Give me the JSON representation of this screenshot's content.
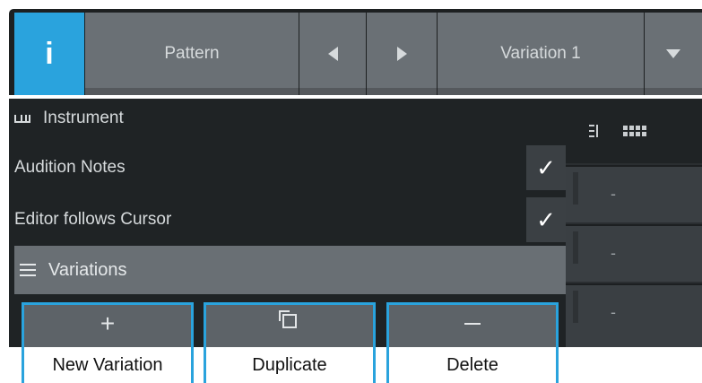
{
  "toolbar": {
    "info_label": "i",
    "pattern_label": "Pattern",
    "variation_label": "Variation 1"
  },
  "panel": {
    "instrument_label": "Instrument",
    "audition_notes_label": "Audition Notes",
    "audition_notes_checked": true,
    "editor_follows_label": "Editor follows Cursor",
    "editor_follows_checked": true,
    "variations_label": "Variations",
    "check_mark": "✓"
  },
  "actions": {
    "new_icon": "+",
    "new_label": "New Variation",
    "duplicate_label": "Duplicate",
    "delete_label": "Delete"
  },
  "right_panel": {
    "rows": [
      "-",
      "-",
      "-"
    ]
  },
  "icons": {
    "info": "info-icon",
    "prev": "arrow-left-icon",
    "next": "arrow-right-icon",
    "dropdown": "chevron-down-icon",
    "instrument": "piano-keys-icon",
    "variations": "menu-icon",
    "new": "plus-icon",
    "duplicate": "duplicate-icon",
    "delete": "minus-icon"
  },
  "colors": {
    "accent": "#2aa3dd",
    "background": "#1f2325",
    "button": "#6a7075"
  }
}
